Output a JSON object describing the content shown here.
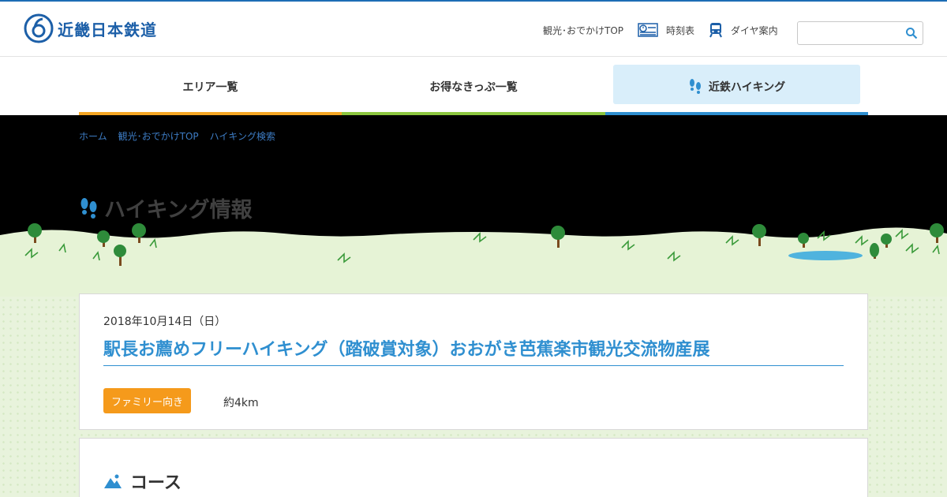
{
  "header": {
    "logo_text": "近畿日本鉄道",
    "nav": [
      {
        "label": "観光･おでかけTOP"
      },
      {
        "label": "時刻表",
        "icon": "timetable-icon"
      },
      {
        "label": "ダイヤ案内",
        "icon": "train-icon"
      }
    ],
    "search": {
      "placeholder": "",
      "icon": "search-icon"
    }
  },
  "tabs": [
    {
      "label": "エリア一覧",
      "color": "#f5a623"
    },
    {
      "label": "お得なきっぷ一覧",
      "color": "#8cc63f"
    },
    {
      "label": "近鉄ハイキング",
      "color": "#2f8fd0",
      "active": true
    }
  ],
  "breadcrumb": [
    "ホーム",
    "観光･おでかけTOP",
    "ハイキング検索"
  ],
  "page_title": "ハイキング情報",
  "event": {
    "date": "2018年10月14日（日）",
    "title": "駅長お薦めフリーハイキング（踏破賞対象）おおがき芭蕉楽市観光交流物産展",
    "badge": "ファミリー向き",
    "distance": "約4km"
  },
  "section": {
    "title": "コース"
  },
  "colors": {
    "brand": "#1c5fa8",
    "accent": "#2f8fd0",
    "badge": "#f59a1b",
    "land": "#e8f3dc"
  }
}
